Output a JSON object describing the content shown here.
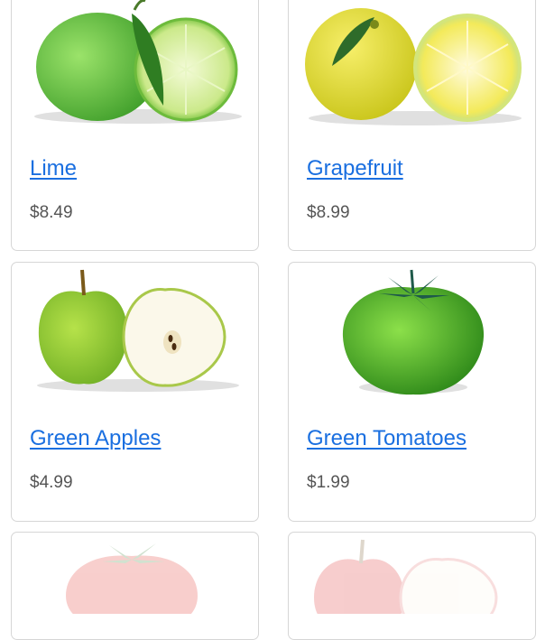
{
  "products": [
    {
      "name": "Lime",
      "price": "$8.49",
      "image": "lime-icon"
    },
    {
      "name": "Grapefruit",
      "price": "$8.99",
      "image": "grapefruit-icon"
    },
    {
      "name": "Green Apples",
      "price": "$4.99",
      "image": "green-apple-icon"
    },
    {
      "name": "Green Tomatoes",
      "price": "$1.99",
      "image": "green-tomato-icon"
    },
    {
      "image": "red-tomato-icon"
    },
    {
      "image": "red-apple-icon"
    }
  ],
  "colors": {
    "link": "#1a6fe0",
    "price": "#555555",
    "border": "#d6d6d6"
  }
}
